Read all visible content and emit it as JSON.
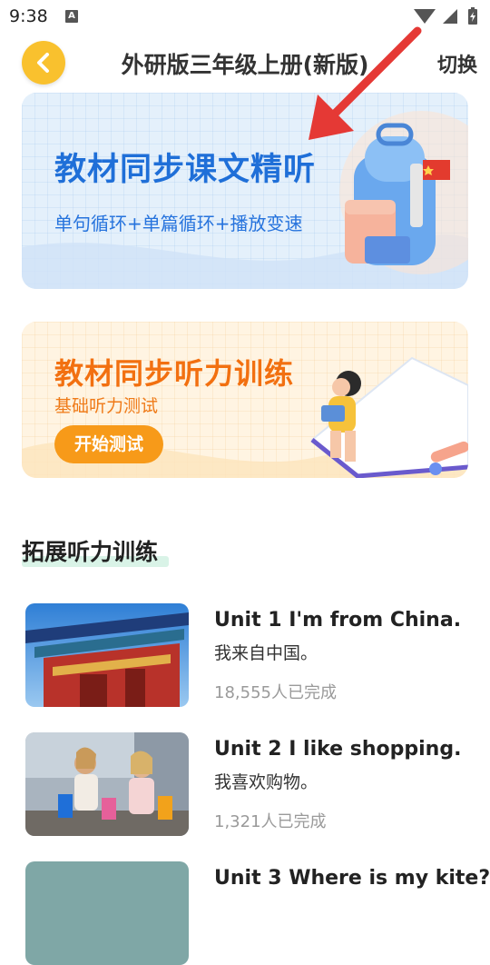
{
  "status": {
    "time": "9:38",
    "indicator": "A"
  },
  "header": {
    "title": "外研版三年级上册(新版)",
    "switch_label": "切换",
    "back_icon": "chevron-left-icon"
  },
  "banner1": {
    "title": "教材同步课文精听",
    "subtitle": "单句循环+单篇循环+播放变速"
  },
  "banner2": {
    "title": "教材同步听力训练",
    "subtitle": "基础听力测试",
    "button_label": "开始测试"
  },
  "section": {
    "title": "拓展听力训练"
  },
  "units": [
    {
      "title": "Unit 1 I'm from China.",
      "subtitle": "我来自中国。",
      "count": "18,555人已完成"
    },
    {
      "title": "Unit 2 I like shopping.",
      "subtitle": "我喜欢购物。",
      "count": "1,321人已完成"
    },
    {
      "title": "Unit 3 Where is my kite?",
      "subtitle": "",
      "count": ""
    }
  ],
  "colors": {
    "accent": "#F9C12E",
    "banner1_text": "#1f6fd8",
    "banner2_text": "#f27010",
    "button": "#f79a19",
    "arrow": "#e53935"
  }
}
